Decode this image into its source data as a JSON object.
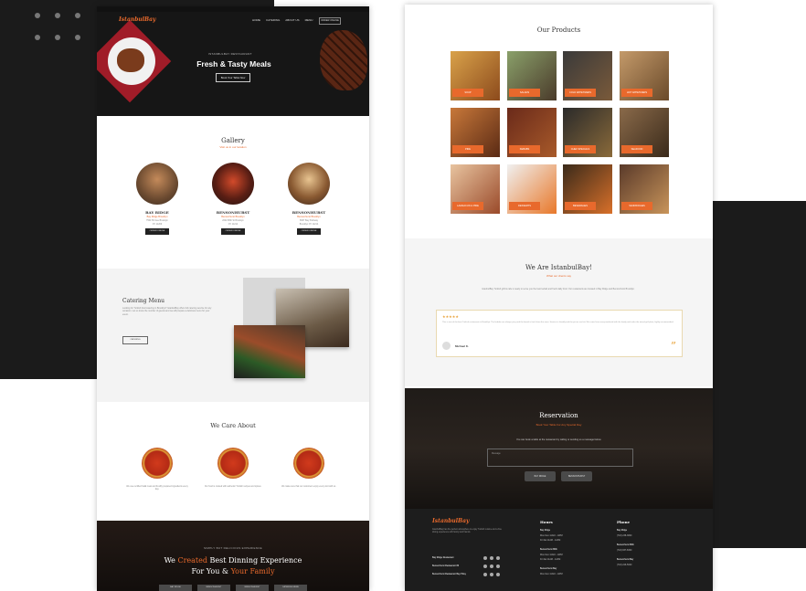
{
  "left_page": {
    "logo": "IstanbulBay",
    "nav": [
      "HOME",
      "CATERING",
      "ABOUT US",
      "MENU"
    ],
    "nav_button": "ORDER ONLINE",
    "hero_small": "ISTANBULBAY RESTAURANT",
    "hero_title": "Fresh & Tasty Meals",
    "hero_button": "Book Your Table Now",
    "gallery_title": "Gallery",
    "gallery_sub": "Visit us in our location",
    "locations": [
      {
        "name": "BAY RIDGE",
        "sub": "Bay Ridge Brooklyn",
        "line1": "7504 5th Ave Brooklyn",
        "line2": "NY 11209",
        "button": "ORDER ONLINE"
      },
      {
        "name": "BENSONHURST",
        "sub": "Bensonhurst Brooklyn",
        "line1": "2002 86th St Brooklyn",
        "line2": "NY 11214",
        "button": "ORDER ONLINE"
      },
      {
        "name": "BENSONHURST",
        "sub": "Bensonhurst Brooklyn",
        "line1": "8667 Bay Parkway",
        "line2": "Brooklyn NY 11214",
        "button": "ORDER ONLINE"
      }
    ],
    "catering_title": "Catering Menu",
    "catering_text": "Looking for Turkish food catering in Brooklyn? IstanbulBay offers full catering service for any occasion. Let us know the number of guests and we will prepare a delicious menu for your event.",
    "catering_button": "CATERING",
    "care_title": "We Care About",
    "care_items": [
      "We use certified halal meat and freshly prepared ingredients every day.",
      "Our food is cooked with authentic Turkish recipes and spices.",
      "We make sure that our customers enjoy every visit with us."
    ],
    "footer_small": "SIMPLY BUT DELICIOUS EXPERIENCE",
    "footer_title_1a": "We ",
    "footer_title_1b": "Created",
    "footer_title_1c": " Best Dinning Experience",
    "footer_title_2a": "For You & ",
    "footer_title_2b": "Your Family",
    "footer_buttons": [
      "BAY RIDGE",
      "BENSONHURST",
      "BENSONHURST",
      "CATERING MENU"
    ]
  },
  "right_page": {
    "products_title": "Our Products",
    "products": [
      "SOUP",
      "SALADS",
      "COLD APPETIZERS",
      "HOT APPETIZERS",
      "PIDE",
      "KEBABS",
      "CHEF SPECIALS",
      "SEAFOOD",
      "LAHMACUN & PIDE",
      "DESSERTS",
      "BEVERAGES",
      "SANDWICHES"
    ],
    "weare_title": "We Are IstanbulBay!",
    "weare_sub": "What our clients say",
    "weare_text": "IstanbulBay Turkish grill & cafe is ready to serve you the best kebab and fresh daily food. Our restaurants are located in Bay Ridge and Bensonhurst Brooklyn.",
    "review_stars": "★★★★★",
    "review_text": "This is one of the best Turkish restaurants in Brooklyn. The kebabs are always juicy and the bread is fresh from the oven. Service is friendly and the prices are fair. We come here every weekend with the family and order the mixed grill plate, highly recommended.",
    "review_name": "Michael K.",
    "quote": "”",
    "resv_title": "Reservation",
    "resv_sub": "Book Your Table For Any Special Day",
    "resv_text": "You can book a table at the restaurant by calling or sending us a message below.",
    "resv_placeholder": "Message",
    "resv_buttons": [
      "BAY RIDGE",
      "BENSONHURST"
    ],
    "footer_logo": "IstanbulBay",
    "footer_text": "IstanbulBay has the perfect atmosphere to enjoy Turkish cuisine and a fine dining experience with family and friends.",
    "footer_locations": [
      "Bay Ridge Restaurant",
      "Bensonhurst Restaurant 86",
      "Bensonhurst Restaurant Bay Pkwy"
    ],
    "hours_title": "Hours",
    "hours": [
      {
        "name": "Bay Ridge",
        "lines": [
          "Mon-Sun  11AM - 11PM",
          "Fri-Sat  11AM - 12AM"
        ]
      },
      {
        "name": "Bensonhurst 86th",
        "lines": [
          "Mon-Sun  11AM - 11PM",
          "Fri-Sat  11AM - 12AM"
        ]
      },
      {
        "name": "Bensonhurst Bay",
        "lines": [
          "Mon-Sun  11AM - 11PM"
        ]
      }
    ],
    "phone_title": "Phone",
    "phones": [
      {
        "name": "Bay Ridge",
        "number": "(718) 238-3800"
      },
      {
        "name": "Bensonhurst 86th",
        "number": "(718) 837-8300"
      },
      {
        "name": "Bensonhurst Bay",
        "number": "(718) 226-5000"
      }
    ]
  },
  "colors": {
    "accent": "#e8692c",
    "dark": "#1b1b1b",
    "gold": "#e8a23a"
  }
}
